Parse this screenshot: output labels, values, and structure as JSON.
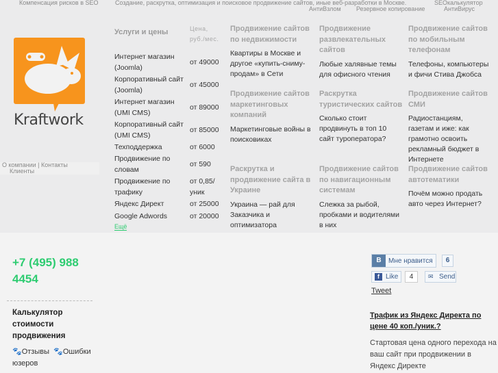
{
  "top_links": {
    "compensation": "Компенсация рисков в SEO",
    "tagline": "Создание, раскрутка, оптимизация и поисковое продвижение сайтов, иные веб-разработки в Москве.",
    "seo_calc": "SEOкалькулятор",
    "antihack": "АнтиВзлом",
    "backup": "Резервное копирование",
    "antivirus": "АнтиВирус"
  },
  "logo": {
    "text": "Kraftwork",
    "color": "#f7941d"
  },
  "nav": {
    "about": "О компании",
    "contacts": "Контакты",
    "clients": "Клиенты"
  },
  "services": {
    "title": "Услуги и цены",
    "price_header": "Цена, руб./мес.",
    "more": "Ещё",
    "items": [
      {
        "name": "Интернет магазин (Joomla)",
        "price": "от 49000"
      },
      {
        "name": "Корпоративный сайт (Joomla)",
        "price": "от 45000"
      },
      {
        "name": "Интернет магазин (UMI CMS)",
        "price": "от 89000"
      },
      {
        "name": "Корпоративный сайт (UMI CMS)",
        "price": "от 85000"
      },
      {
        "name": "Техподдержка",
        "price": "от 6000"
      },
      {
        "name": "Продвижение по словам",
        "price": "от 590"
      },
      {
        "name": "Продвижение по трафику",
        "price": "от 0,85/уник"
      },
      {
        "name": "Яндекс Директ",
        "price": "от 25000"
      },
      {
        "name": "Google Adwords",
        "price": "от 20000"
      }
    ]
  },
  "cards": [
    {
      "title": "Продвижение сайтов по недвижимости",
      "text": "Квартиры в Москве и другое «купить-сниму-продам» в Сети"
    },
    {
      "title": "Продвижение развлекательных сайтов",
      "text": "Любые халявные темы для офисного чтения"
    },
    {
      "title": "Продвижение сайтов по мобильным телефонам",
      "text": "Телефоны, компьютеры и фичи Стива Джобса"
    },
    {
      "title": "Продвижение сайтов маркетинговых компаний",
      "text": "Маркетинговые войны в поисковиках"
    },
    {
      "title": "Раскрутка туристических сайтов",
      "text": "Сколько стоит продвинуть в топ 10 сайт туроператора?"
    },
    {
      "title": "Продвижение сайтов СМИ",
      "text": "Радиостанциям, газетам и иже: как грамотно освоить рекламный бюджет в Интернете"
    },
    {
      "title": "Раскрутка и продвижение сайта в Украине",
      "text": "Украина — рай для Заказчика и оптимизатора"
    },
    {
      "title": "Продвижение сайтов по навигационным системам",
      "text": "Слежка за рыбой, пробками и водителями в них"
    },
    {
      "title": "Продвижение сайтов автотематики",
      "text": "Почём можно продать авто через Интернет?"
    }
  ],
  "phone": "+7 (495) 988 4454",
  "calculator": {
    "title": "Калькулятор стоимости продвижения",
    "link1": "Отзывы",
    "link2": "Ошибки юзеров"
  },
  "social": {
    "vk_icon": "В",
    "vk_label": "Мне нравится",
    "vk_count": "6",
    "fb_label": "Like",
    "fb_count": "4",
    "send_label": "Send",
    "tweet": "Tweet"
  },
  "promo": {
    "title": "Трафик из Яндекс Директа по цене 40 коп./уник.?",
    "text": "Стартовая цена одного перехода на ваш сайт при продвижении в Яндекс Директе"
  },
  "accent": "#2ecc71"
}
